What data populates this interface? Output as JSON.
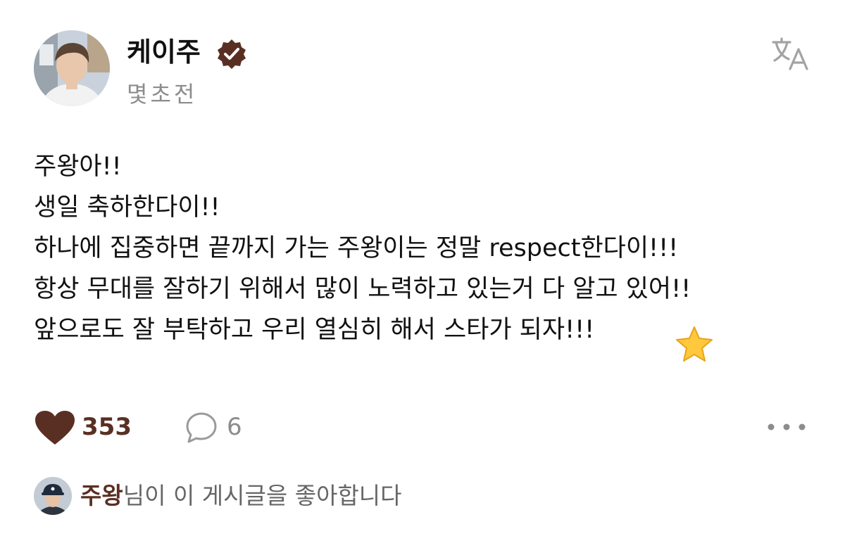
{
  "post": {
    "author_name": "케이주",
    "timestamp": "몇초전",
    "body_lines": [
      "주왕아!!",
      "생일 축하한다이!!",
      "하나에 집중하면 끝까지 가는 주왕이는 정말 respect한다이!!!",
      "항상 무대를 잘하기 위해서 많이 노력하고 있는거 다 알고 있어!!",
      "앞으로도 잘 부탁하고 우리 열심히 해서 스타가 되자!!!"
    ],
    "like_count": "353",
    "comment_count": "6",
    "liked_by": {
      "name": "주왕",
      "suffix": "님이 이 게시글을 좋아합니다"
    }
  },
  "icons": {
    "verified": "verified-badge-icon",
    "translate": "translate-icon",
    "star": "star-emoji-icon",
    "heart": "heart-icon",
    "comment": "comment-bubble-icon",
    "more": "more-dots-icon"
  },
  "colors": {
    "accent": "#5a2f23",
    "text": "#111111",
    "muted": "#8c8c8c",
    "star": "#ffc83d"
  }
}
